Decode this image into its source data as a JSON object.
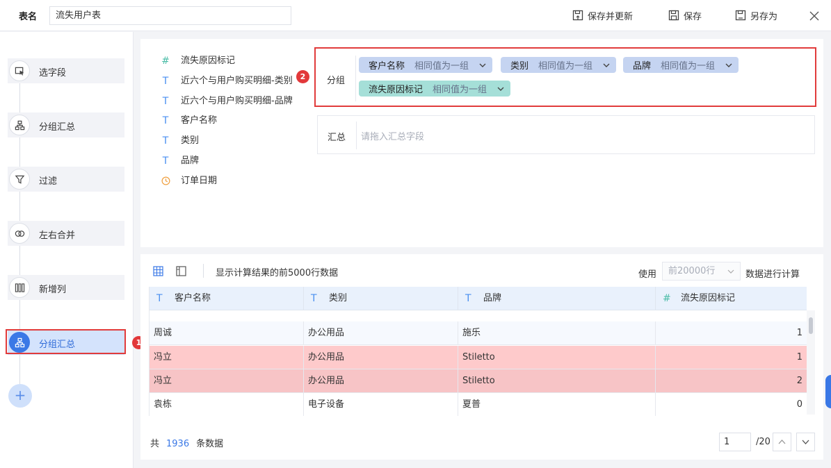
{
  "header": {
    "table_name_label": "表名",
    "table_name_value": "流失用户表",
    "save_update_label": "保存并更新",
    "save_label": "保存",
    "save_as_label": "另存为"
  },
  "steps": [
    {
      "label": "选字段",
      "icon": "select-field-icon"
    },
    {
      "label": "分组汇总",
      "icon": "group-summary-icon"
    },
    {
      "label": "过滤",
      "icon": "filter-icon"
    },
    {
      "label": "左右合并",
      "icon": "merge-icon"
    },
    {
      "label": "新增列",
      "icon": "add-column-icon"
    },
    {
      "label": "分组汇总",
      "icon": "group-summary-icon",
      "active": true
    }
  ],
  "badges": {
    "one": "1",
    "two": "2"
  },
  "field_list": [
    {
      "type": "#",
      "name": "流失原因标记"
    },
    {
      "type": "T",
      "name": "近六个与用户购买明细-类别"
    },
    {
      "type": "T",
      "name": "近六个与用户购买明细-品牌"
    },
    {
      "type": "T",
      "name": "客户名称"
    },
    {
      "type": "T",
      "name": "类别"
    },
    {
      "type": "T",
      "name": "品牌"
    },
    {
      "type": "date",
      "name": "订单日期"
    }
  ],
  "group": {
    "label": "分组",
    "chips": [
      {
        "name": "客户名称",
        "mode": "相同值为一组"
      },
      {
        "name": "类别",
        "mode": "相同值为一组"
      },
      {
        "name": "品牌",
        "mode": "相同值为一组"
      },
      {
        "name": "流失原因标记",
        "mode": "相同值为一组"
      }
    ]
  },
  "summary": {
    "label": "汇总",
    "placeholder": "请拖入汇总字段"
  },
  "preview": {
    "info": "显示计算结果的前5000行数据",
    "use_label": "使用",
    "rows_select": "前20000行",
    "calc_label": "数据进行计算"
  },
  "table": {
    "columns": [
      {
        "type": "T",
        "name": "客户名称"
      },
      {
        "type": "T",
        "name": "类别"
      },
      {
        "type": "T",
        "name": "品牌"
      },
      {
        "type": "#",
        "name": "流失原因标记"
      }
    ],
    "rows": [
      [
        "周诚",
        "办公用品",
        "施乐",
        "1"
      ],
      [
        "冯立",
        "办公用品",
        "Stiletto",
        "1"
      ],
      [
        "冯立",
        "办公用品",
        "Stiletto",
        "2"
      ],
      [
        "袁栋",
        "电子设备",
        "夏普",
        "0"
      ]
    ],
    "highlight_color_a": "#fecacb",
    "highlight_color_b": "#f7c4c6"
  },
  "footer": {
    "total_prefix": "共",
    "total_count": "1936",
    "total_suffix": "条数据",
    "page_current": "1",
    "page_total": "/20"
  },
  "colors": {
    "accent": "#3a78e6",
    "annotation_red": "#e13b3b"
  }
}
